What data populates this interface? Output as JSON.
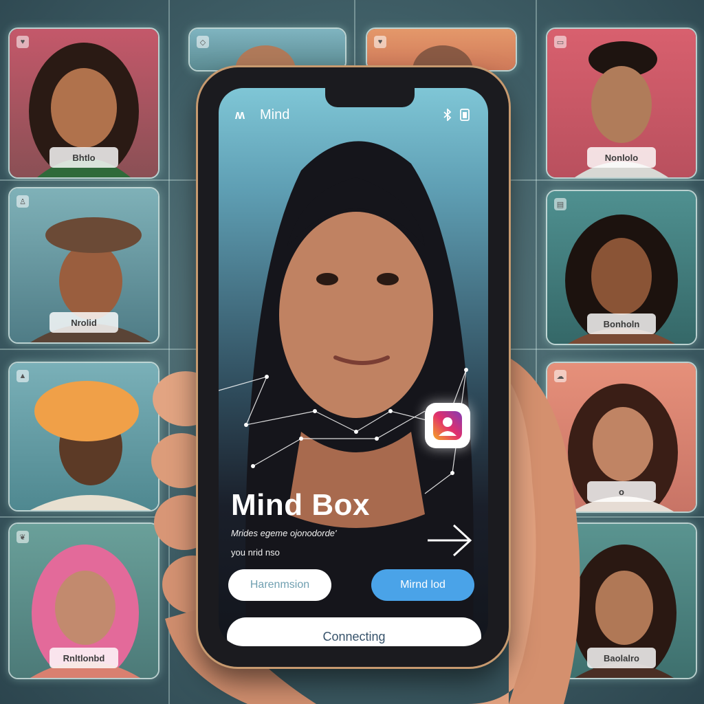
{
  "app": {
    "name": "Mind",
    "title": "Mind Box",
    "subtitle": "Mrides egeme ojonodorde'",
    "caption": "you nrid nso"
  },
  "buttons": {
    "left": "Harenmsion",
    "right": "Mirnd lod",
    "wide": "Connecting"
  },
  "profiles": [
    {
      "name": "Bhtlo",
      "bg": "#b35868"
    },
    {
      "name": "Nrolid",
      "bg": "#4f7c86"
    },
    {
      "name": "",
      "bg": "#5b8b92"
    },
    {
      "name": "Rnltlonbd",
      "bg": "#5b8a86"
    },
    {
      "name": "Nonlolo",
      "bg": "#c95a6a"
    },
    {
      "name": "Bonholn",
      "bg": "#3f7a7f"
    },
    {
      "name": "o",
      "bg": "#d9846e"
    },
    {
      "name": "Baolalro",
      "bg": "#4c8182"
    }
  ],
  "colors": {
    "accent": "#4aa3e8",
    "frame": "#c79a6f",
    "card_border": "#e6faf5"
  },
  "icons": {
    "logo": "app-logo-icon",
    "status1": "bluetooth-icon",
    "status2": "battery-icon",
    "badge": "instagram-icon"
  }
}
